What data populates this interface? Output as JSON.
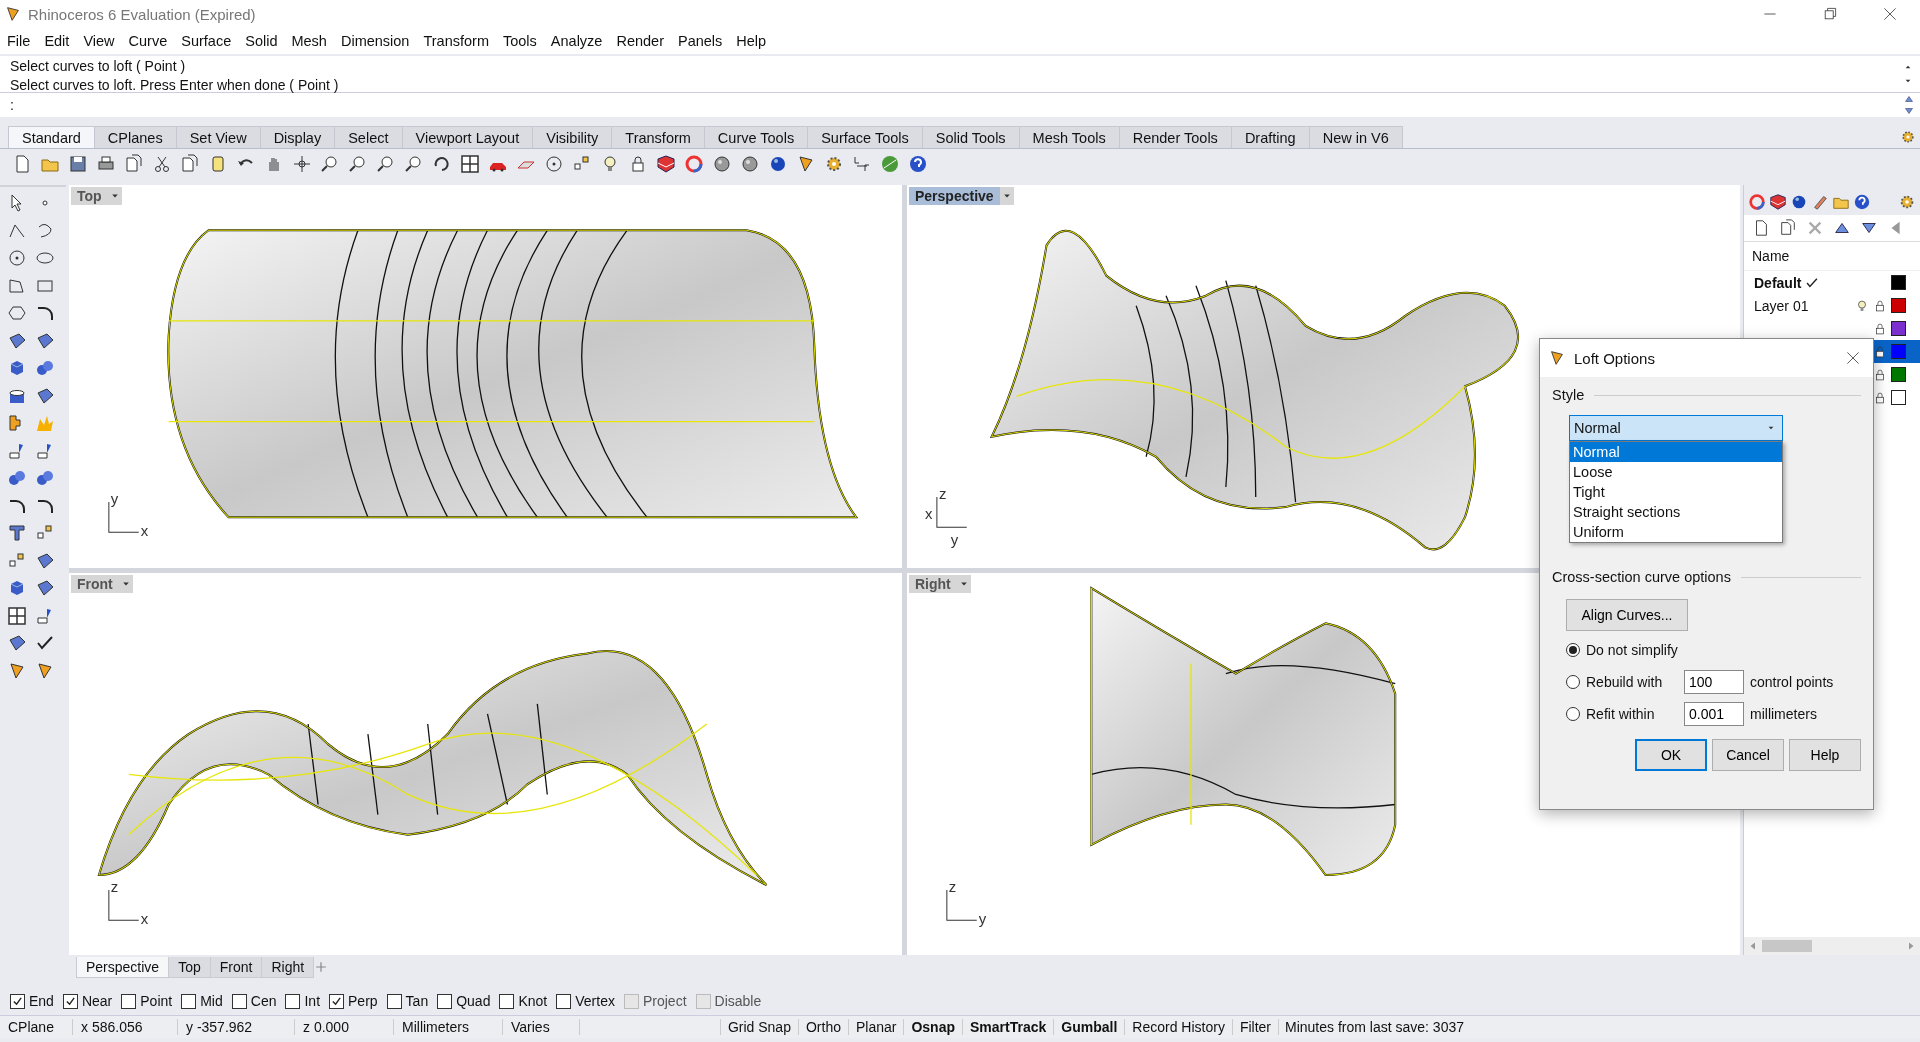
{
  "window": {
    "title": "Rhinoceros 6 Evaluation (Expired)"
  },
  "menu": [
    "File",
    "Edit",
    "View",
    "Curve",
    "Surface",
    "Solid",
    "Mesh",
    "Dimension",
    "Transform",
    "Tools",
    "Analyze",
    "Render",
    "Panels",
    "Help"
  ],
  "command": {
    "history": [
      "Select curves to loft ( Point )",
      "Select curves to loft. Press Enter when done ( Point )"
    ],
    "prompt": ":"
  },
  "toolbar_tabs": [
    {
      "label": "Standard",
      "selected": true
    },
    {
      "label": "CPlanes",
      "selected": false
    },
    {
      "label": "Set View",
      "selected": false
    },
    {
      "label": "Display",
      "selected": false
    },
    {
      "label": "Select",
      "selected": false
    },
    {
      "label": "Viewport Layout",
      "selected": false
    },
    {
      "label": "Visibility",
      "selected": false
    },
    {
      "label": "Transform",
      "selected": false
    },
    {
      "label": "Curve Tools",
      "selected": false
    },
    {
      "label": "Surface Tools",
      "selected": false
    },
    {
      "label": "Solid Tools",
      "selected": false
    },
    {
      "label": "Mesh Tools",
      "selected": false
    },
    {
      "label": "Render Tools",
      "selected": false
    },
    {
      "label": "Drafting",
      "selected": false
    },
    {
      "label": "New in V6",
      "selected": false
    }
  ],
  "viewports": [
    {
      "title": "Top",
      "selected": false,
      "axes": [
        "y",
        "x"
      ]
    },
    {
      "title": "Perspective",
      "selected": true,
      "axes": [
        "z",
        "x",
        "y"
      ]
    },
    {
      "title": "Front",
      "selected": false,
      "axes": [
        "z",
        "x"
      ]
    },
    {
      "title": "Right",
      "selected": false,
      "axes": [
        "z",
        "y"
      ]
    }
  ],
  "viewport_tabs": [
    {
      "label": "Perspective",
      "selected": true
    },
    {
      "label": "Top",
      "selected": false
    },
    {
      "label": "Front",
      "selected": false
    },
    {
      "label": "Right",
      "selected": false
    }
  ],
  "layers": {
    "header": "Name",
    "rows": [
      {
        "name": "Default",
        "current": true,
        "color": "#000000",
        "selected": false
      },
      {
        "name": "Layer 01",
        "current": false,
        "color": "#cc0000",
        "selected": false
      },
      {
        "color": "#7b2fcf",
        "selected": false
      },
      {
        "color": "#0000ff",
        "selected": true
      },
      {
        "color": "#007800",
        "selected": false
      },
      {
        "color": "#ffffff",
        "selected": false
      }
    ]
  },
  "dialog": {
    "title": "Loft Options",
    "style_label": "Style",
    "style": {
      "value": "Normal",
      "expanded": true,
      "options": [
        {
          "label": "Normal",
          "selected": true
        },
        {
          "label": "Loose",
          "selected": false
        },
        {
          "label": "Tight",
          "selected": false
        },
        {
          "label": "Straight sections",
          "selected": false
        },
        {
          "label": "Uniform",
          "selected": false
        }
      ]
    },
    "cross_section_label": "Cross-section curve options",
    "align_button": "Align Curves...",
    "simplify": [
      {
        "label": "Do not simplify",
        "selected": true
      },
      {
        "label": "Rebuild with",
        "selected": false,
        "value": "100",
        "unit": "control points"
      },
      {
        "label": "Refit within",
        "selected": false,
        "value": "0.001",
        "unit": "millimeters"
      }
    ],
    "buttons": [
      {
        "label": "OK",
        "default": true
      },
      {
        "label": "Cancel",
        "default": false
      },
      {
        "label": "Help",
        "default": false
      }
    ]
  },
  "osnaps": [
    {
      "label": "End",
      "checked": true,
      "disabled": false
    },
    {
      "label": "Near",
      "checked": true,
      "disabled": false
    },
    {
      "label": "Point",
      "checked": false,
      "disabled": false
    },
    {
      "label": "Mid",
      "checked": false,
      "disabled": false
    },
    {
      "label": "Cen",
      "checked": false,
      "disabled": false
    },
    {
      "label": "Int",
      "checked": false,
      "disabled": false
    },
    {
      "label": "Perp",
      "checked": true,
      "disabled": false
    },
    {
      "label": "Tan",
      "checked": false,
      "disabled": false
    },
    {
      "label": "Quad",
      "checked": false,
      "disabled": false
    },
    {
      "label": "Knot",
      "checked": false,
      "disabled": false
    },
    {
      "label": "Vertex",
      "checked": false,
      "disabled": false
    },
    {
      "label": "Project",
      "checked": false,
      "disabled": true
    },
    {
      "label": "Disable",
      "checked": false,
      "disabled": true
    }
  ],
  "status_bar": {
    "cells": [
      "CPlane",
      "x 586.056",
      "y -357.962",
      "z 0.000",
      "Millimeters",
      "Varies"
    ],
    "panes": [
      {
        "label": "Grid Snap",
        "on": false
      },
      {
        "label": "Ortho",
        "on": false
      },
      {
        "label": "Planar",
        "on": false
      },
      {
        "label": "Osnap",
        "on": true
      },
      {
        "label": "SmartTrack",
        "on": true
      },
      {
        "label": "Gumball",
        "on": true
      },
      {
        "label": "Record History",
        "on": false
      },
      {
        "label": "Filter",
        "on": false
      }
    ],
    "info": "Minutes from last save: 3037"
  }
}
